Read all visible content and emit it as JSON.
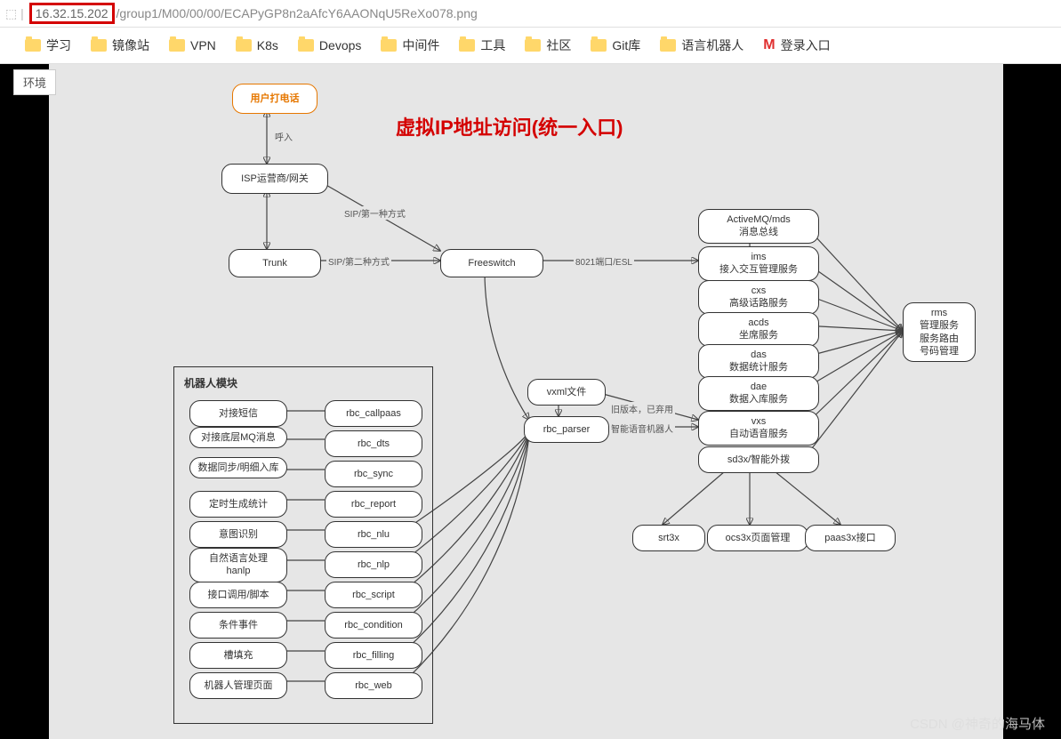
{
  "url": {
    "ip": "16.32.15.202",
    "path": "/group1/M00/00/00/ECAPyGP8n2aAfcY6AAONqU5ReXo078.png"
  },
  "bookmarks": [
    "学习",
    "镜像站",
    "VPN",
    "K8s",
    "Devops",
    "中间件",
    "工具",
    "社区",
    "Git库",
    "语言机器人"
  ],
  "login": "登录入口",
  "env_tab": "环境",
  "title": "虚拟IP地址访问(统一入口)",
  "watermark": "CSDN @神奇的海马体",
  "nodes": {
    "start": "用户打电话",
    "isp": "ISP运营商/网关",
    "trunk": "Trunk",
    "fs": "Freeswitch",
    "amq": "ActiveMQ/mds\n消息总线",
    "ims": "ims\n接入交互管理服务",
    "cxs": "cxs\n高级话路服务",
    "acds": "acds\n坐席服务",
    "das": "das\n数据统计服务",
    "dae": "dae\n数据入库服务",
    "vxs": "vxs\n自动语音服务",
    "sd3x": "sd3x/智能外拨",
    "rms": "rms\n管理服务\n服务路由\n号码管理",
    "vxml": "vxml文件",
    "parser": "rbc_parser",
    "srt3x": "srt3x",
    "ocs3x": "ocs3x页面管理",
    "paas3x": "paas3x接口",
    "robot_title": "机器人模块",
    "rl": [
      "对接短信",
      "对接底层MQ消息",
      "数据同步/明细入库",
      "定时生成统计",
      "意图识别",
      "自然语言处理\nhanlp",
      "接口调用/脚本",
      "条件事件",
      "槽填充",
      "机器人管理页面"
    ],
    "rr": [
      "rbc_callpaas",
      "rbc_dts",
      "rbc_sync",
      "rbc_report",
      "rbc_nlu",
      "rbc_nlp",
      "rbc_script",
      "rbc_condition",
      "rbc_filling",
      "rbc_web"
    ]
  },
  "edge_labels": {
    "huru": "呼入",
    "sip1": "SIP/第一种方式",
    "sip2": "SIP/第二种方式",
    "esl": "8021端口/ESL",
    "old": "旧版本，已弃用",
    "ai": "智能语音机器人"
  }
}
